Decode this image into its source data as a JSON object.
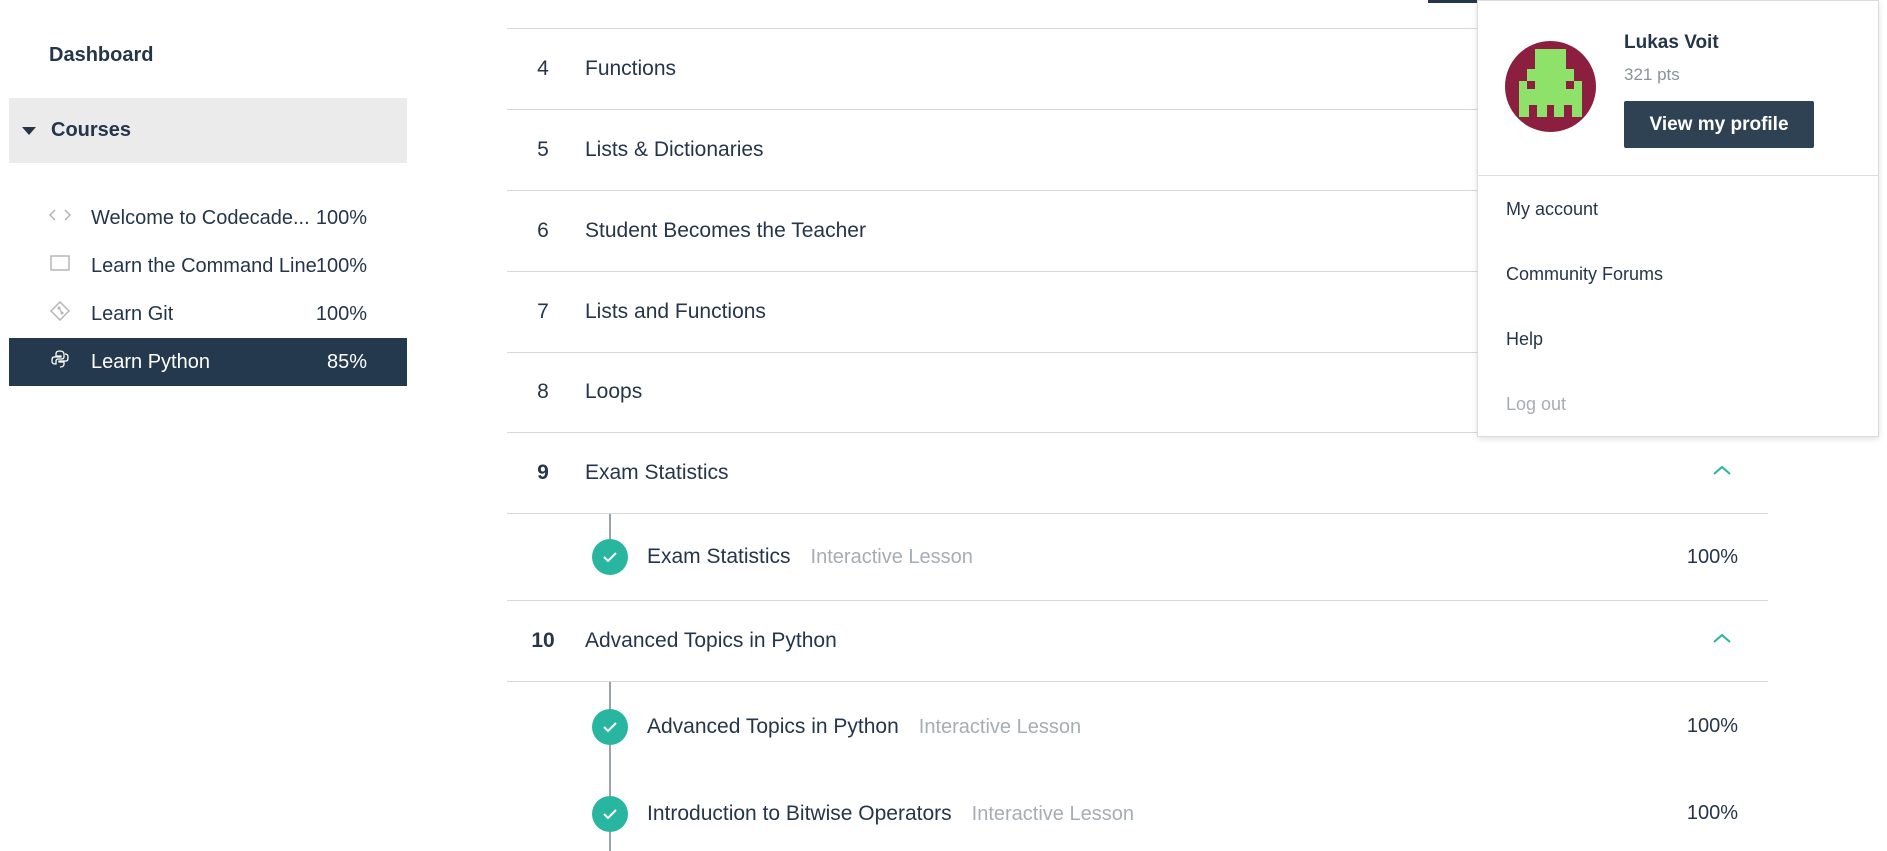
{
  "sidebar": {
    "dashboard_label": "Dashboard",
    "courses_label": "Courses",
    "courses": [
      {
        "icon": "code-brackets-icon",
        "title": "Welcome to Codecade...",
        "percent": "100%",
        "active": false
      },
      {
        "icon": "terminal-window-icon",
        "title": "Learn the Command Line",
        "percent": "100%",
        "active": false
      },
      {
        "icon": "git-diamond-icon",
        "title": "Learn Git",
        "percent": "100%",
        "active": false
      },
      {
        "icon": "python-logo-icon",
        "title": "Learn Python",
        "percent": "85%",
        "active": true
      }
    ]
  },
  "units": [
    {
      "number": "4",
      "title": "Functions"
    },
    {
      "number": "5",
      "title": "Lists & Dictionaries"
    },
    {
      "number": "6",
      "title": "Student Becomes the Teacher"
    },
    {
      "number": "7",
      "title": "Lists and Functions"
    },
    {
      "number": "8",
      "title": "Loops"
    },
    {
      "number": "9",
      "title": "Exam Statistics",
      "expanded": true,
      "lessons": [
        {
          "title": "Exam Statistics",
          "type": "Interactive Lesson",
          "percent": "100%"
        }
      ]
    },
    {
      "number": "10",
      "title": "Advanced Topics in Python",
      "expanded": true,
      "lessons": [
        {
          "title": "Advanced Topics in Python",
          "type": "Interactive Lesson",
          "percent": "100%"
        },
        {
          "title": "Introduction to Bitwise Operators",
          "type": "Interactive Lesson",
          "percent": "100%"
        }
      ]
    }
  ],
  "user_menu": {
    "name": "Lukas Voit",
    "points": "321 pts",
    "profile_button": "View my profile",
    "items": [
      "My account",
      "Community Forums",
      "Help",
      "Log out"
    ]
  },
  "colors": {
    "navy": "#25364a",
    "active_bg": "#24384e",
    "teal_check": "#29b6a0",
    "avatar_bg": "#8c1e3f",
    "avatar_fg": "#8ee26a"
  }
}
